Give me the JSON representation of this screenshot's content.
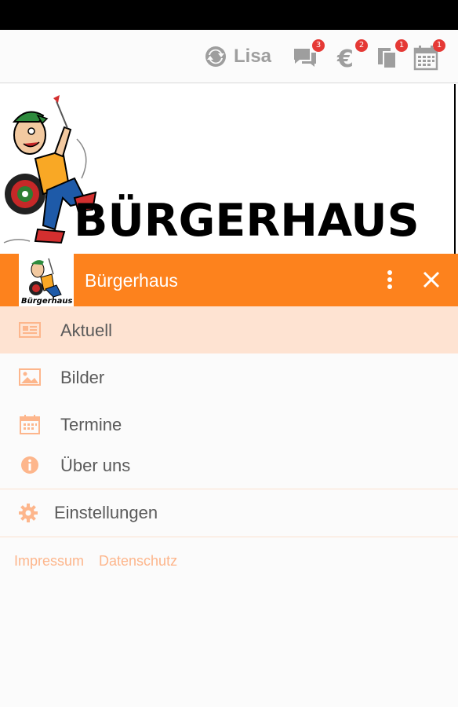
{
  "topbar": {
    "user_name": "Lisa",
    "icons": [
      {
        "name": "chat-icon",
        "badge": "3"
      },
      {
        "name": "euro-icon",
        "badge": "2"
      },
      {
        "name": "documents-icon",
        "badge": "1"
      },
      {
        "name": "calendar-icon",
        "badge": "1"
      }
    ]
  },
  "banner": {
    "title": "BÜRGERHAUS",
    "logo_caption": "Bürgerhaus"
  },
  "drawer": {
    "title": "Bürgerhaus",
    "items": [
      {
        "label": "Aktuell",
        "icon": "newspaper-icon",
        "active": true
      },
      {
        "label": "Bilder",
        "icon": "image-icon",
        "active": false
      },
      {
        "label": "Termine",
        "icon": "calendar-icon",
        "active": false
      },
      {
        "label": "Über uns",
        "icon": "info-icon",
        "active": false
      }
    ],
    "settings_label": "Einstellungen"
  },
  "footer": {
    "impressum": "Impressum",
    "datenschutz": "Datenschutz"
  },
  "colors": {
    "accent": "#fd821d",
    "active_bg": "#fee3d2",
    "badge": "#e53935",
    "icon": "#fdb68c"
  }
}
